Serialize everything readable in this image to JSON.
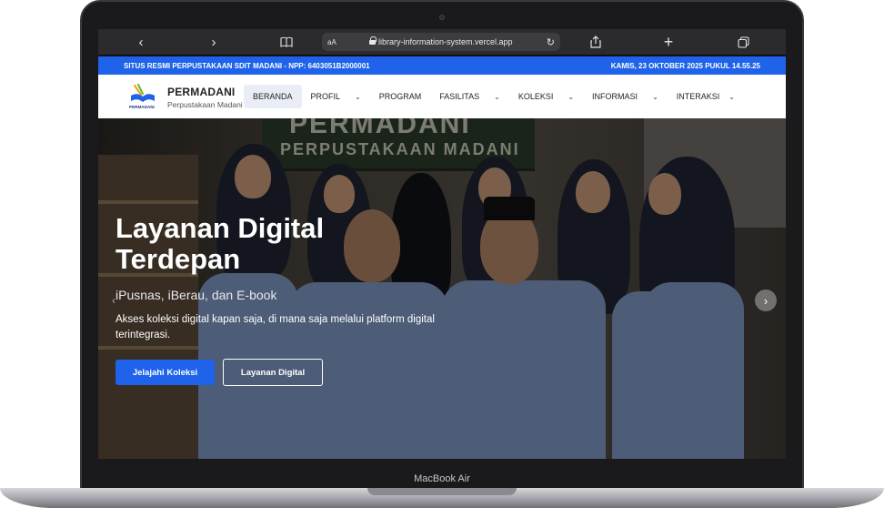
{
  "device": {
    "model_label": "MacBook Air"
  },
  "browser": {
    "back_icon": "‹",
    "forward_icon": "›",
    "bookmarks_icon": "book-icon",
    "text_size_label": "aA",
    "url": "library-information-system.vercel.app",
    "reload_icon": "↻",
    "share_icon": "share-icon",
    "new_tab_icon": "+",
    "tabs_icon": "tabs-icon"
  },
  "topbar": {
    "left_text": "SITUS RESMI PERPUSTAKAAN SDIT MADANI - NPP: 6403051B2000001",
    "right_text": "KAMIS, 23 OKTOBER 2025 PUKUL 14.55.25",
    "color": "#1e63e9"
  },
  "brand": {
    "name": "PERMADANI",
    "subtitle": "Perpustakaan Madani",
    "logo_text": "PERMADANI"
  },
  "nav": {
    "items": [
      {
        "label": "BERANDA",
        "active": true,
        "dropdown": false
      },
      {
        "label": "PROFIL",
        "active": false,
        "dropdown": true
      },
      {
        "label": "PROGRAM",
        "active": false,
        "dropdown": false
      },
      {
        "label": "FASILITAS",
        "active": false,
        "dropdown": true
      },
      {
        "label": "KOLEKSI",
        "active": false,
        "dropdown": true
      },
      {
        "label": "INFORMASI",
        "active": false,
        "dropdown": true
      },
      {
        "label": "INTERAKSI",
        "active": false,
        "dropdown": true
      }
    ],
    "chevron_icon": "chevron-down-icon"
  },
  "hero": {
    "background_sign": "PERMADANI\nPERPUSTAKAAN MADANI",
    "title": "Layanan Digital Terdepan",
    "subtitle": "iPusnas, iBerau, dan E-book",
    "description": "Akses koleksi digital kapan saja, di mana saja melalui platform digital terintegrasi.",
    "primary_button": "Jelajahi Koleksi",
    "secondary_button": "Layanan Digital",
    "prev_icon": "‹",
    "next_icon": "›"
  }
}
